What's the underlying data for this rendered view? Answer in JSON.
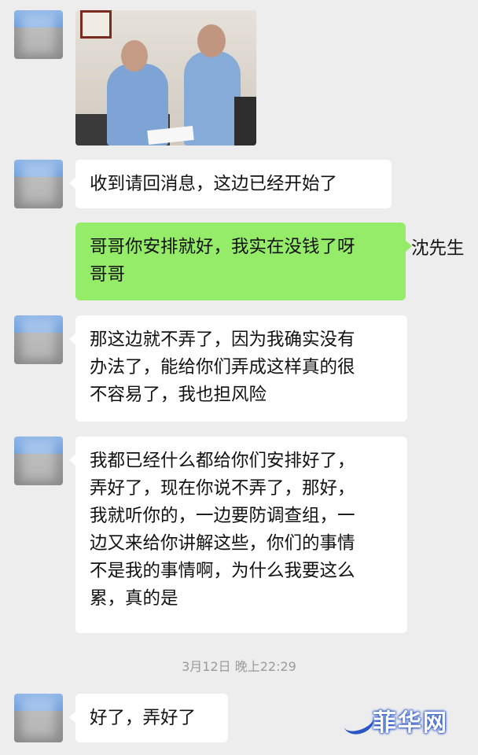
{
  "messages": [
    {
      "id": "m1",
      "type": "image",
      "sender": "other"
    },
    {
      "id": "m2",
      "type": "text",
      "sender": "other",
      "text": "收到请回消息，这边已经开始了"
    },
    {
      "id": "m3",
      "type": "text",
      "sender": "me",
      "text": "哥哥你安排就好，我实在没钱了呀\n哥哥",
      "name": "沈先生"
    },
    {
      "id": "m4",
      "type": "text",
      "sender": "other",
      "text": "那这边就不弄了，因为我确实没有\n办法了，能给你们弄成这样真的很\n不容易了，我也担风险"
    },
    {
      "id": "m5",
      "type": "text",
      "sender": "other",
      "text": "我都已经什么都给你们安排好了，\n弄好了，现在你说不弄了，那好，\n我就听你的，一边要防调查组，一\n边又来给你讲解这些，你们的事情\n不是我的事情啊，为什么我要这么\n累，真的是"
    },
    {
      "id": "m6",
      "type": "text",
      "sender": "other",
      "text": "好了，弄好了"
    }
  ],
  "timestamp": "3月12日 晚上22:29",
  "watermark": {
    "text": "菲华网"
  },
  "colors": {
    "background": "#ededed",
    "my_bubble": "#95ec69",
    "other_bubble": "#ffffff",
    "timestamp": "#9b9b9b"
  }
}
